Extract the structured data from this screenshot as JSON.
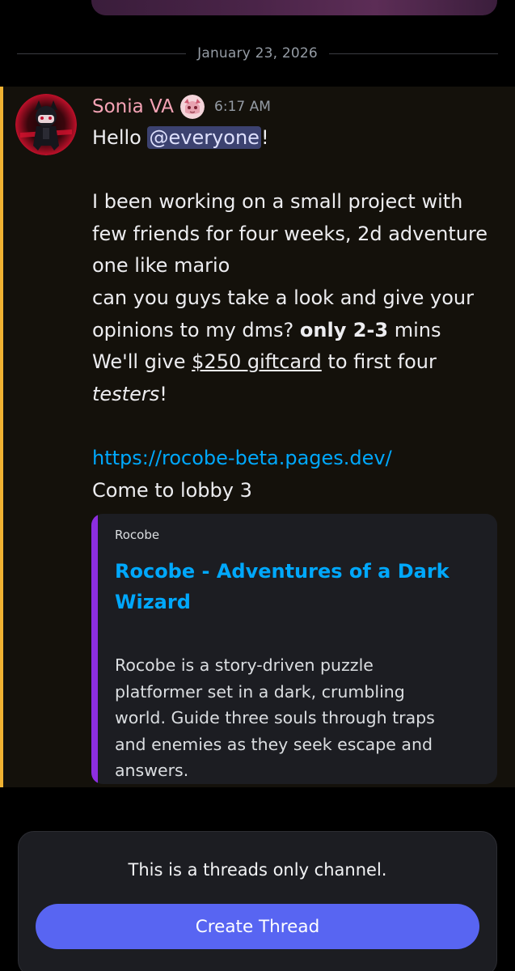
{
  "divider": {
    "date": "January 23, 2026"
  },
  "message": {
    "author": "Sonia VA",
    "time": "6:17 AM",
    "greeting_prefix": "Hello ",
    "mention": "@everyone",
    "greeting_suffix": "!",
    "body_lines": [
      "I been working on a small project with",
      "few friends for four weeks, 2d adventure",
      "one like mario",
      "can you guys take a look and give your"
    ],
    "opinions_prefix": "opinions to my dms? ",
    "opinions_bold": "only 2-3",
    "opinions_suffix": " mins",
    "give_prefix": "We'll give ",
    "give_underline": "$250 giftcard",
    "give_suffix": " to first four",
    "testers_italic": "testers",
    "testers_suffix": "!",
    "link": "https://rocobe-beta.pages.dev/",
    "closing": "Come to lobby 3"
  },
  "embed": {
    "provider": "Rocobe",
    "title_lines": [
      "Rocobe - Adventures of a Dark",
      "Wizard"
    ],
    "description_lines": [
      "Rocobe is a story-driven puzzle",
      "platformer set in a dark, crumbling",
      "world. Guide three souls through traps",
      "and enemies as they seek escape and",
      "answers."
    ]
  },
  "threads": {
    "notice": "This is a threads only channel.",
    "button": "Create Thread"
  },
  "colors": {
    "mention_bar": "#f0b232",
    "link": "#00a8fc",
    "embed_accent": "#8d2ee0",
    "button": "#5865f2",
    "username": "#f5a3b5"
  }
}
